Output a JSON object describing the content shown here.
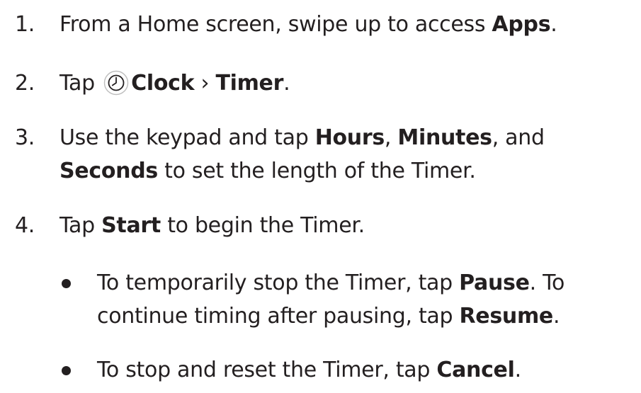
{
  "steps": [
    {
      "number": "1.",
      "parts": [
        "From a Home screen, swipe up to access ",
        "Apps",
        "."
      ]
    },
    {
      "number": "2.",
      "parts": [
        "Tap ",
        "Clock",
        " › ",
        "Timer",
        "."
      ],
      "icon": "clock-icon"
    },
    {
      "number": "3.",
      "line1": [
        "Use the keypad and tap ",
        "Hours",
        ", ",
        "Minutes",
        ", and"
      ],
      "line2": [
        "Seconds",
        " to set the length of the Timer."
      ]
    },
    {
      "number": "4.",
      "parts": [
        "Tap ",
        "Start",
        " to begin the Timer."
      ]
    }
  ],
  "bullets": [
    {
      "line1": [
        "To temporarily stop the Timer, tap ",
        "Pause",
        ". To"
      ],
      "line2": [
        "continue timing after pausing, tap ",
        "Resume",
        "."
      ]
    },
    {
      "line1": [
        "To stop and reset the Timer, tap ",
        "Cancel",
        "."
      ]
    }
  ]
}
